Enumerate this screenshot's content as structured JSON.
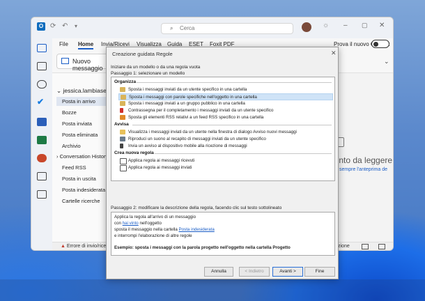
{
  "outlook": {
    "search_placeholder": "Cerca",
    "new_outlook_label": "Prova il nuovo Outlook",
    "tabs": [
      "File",
      "Home",
      "Invia/Ricevi",
      "Visualizza",
      "Guida",
      "ESET",
      "Foxit PDF"
    ],
    "new_message_button": "Nuovo messaggio",
    "account": "jessica.lambiase",
    "folders": [
      "Posta in arrivo",
      "Bozze",
      "Posta inviata",
      "Posta eliminata",
      "Archivio",
      "Conversation History",
      "Feed RSS",
      "Posta in uscita",
      "Posta indesiderata",
      "Cartelle ricerche"
    ],
    "status_error": "Errore di invio/ricezione",
    "status_right": "zione",
    "reading_pane_title": "nento da leggere",
    "reading_pane_link": "sempre l'anteprima de"
  },
  "dialog": {
    "title": "Creazione guidata Regole",
    "start_label": "Iniziare da un modello o da una regola vuota",
    "step1_label": "Passaggio 1: selezionare un modello",
    "groups": [
      {
        "name": "Organizza",
        "items": [
          "Sposta i messaggi inviati da un utente specifico in una cartella",
          "Sposta i messaggi con parole specifiche nell'oggetto in una cartella",
          "Sposta i messaggi inviati a un gruppo pubblico in una cartella",
          "Contrassegna per il completamento i messaggi inviati da un utente specifico",
          "Sposta gli elementi RSS relativi a un feed RSS specifico in una cartella"
        ]
      },
      {
        "name": "Avvisa",
        "items": [
          "Visualizza i messaggi inviati da un utente nella finestra di dialogo Avviso nuovi messaggi",
          "Riproduci un suono al recapito di messaggi inviati da un utente specifico",
          "Invia un avviso al dispositivo mobile alla ricezione di messaggi"
        ]
      },
      {
        "name": "Crea nuova regola",
        "items": [
          "Applica regola ai messaggi ricevuti",
          "Applica regola ai messaggi inviati"
        ]
      }
    ],
    "selected_item": "Sposta i messaggi con parole specifiche nell'oggetto in una cartella",
    "step2_label": "Passaggio 2: modificare la descrizione della regola, facendo clic sul testo sottolineato",
    "desc": {
      "line1": "Applica la regola all'arrivo di un messaggio",
      "line2_pre": "con ",
      "line2_link": "hai vinto",
      "line2_post": " nell'oggetto",
      "line3_pre": "sposta il messaggio nella cartella ",
      "line3_link": "Posta indesiderata",
      "line4": " e interrompi l'elaborazione di altre regole"
    },
    "example": "Esempio: sposta i messaggi con la parola progetto nell'oggetto nella cartella Progetto",
    "buttons": {
      "cancel": "Annulla",
      "back": "< Indietro",
      "next": "Avanti >",
      "finish": "Fine"
    }
  },
  "colors": {
    "accent": "#1a5dc6",
    "selection": "#cfe3f7"
  }
}
